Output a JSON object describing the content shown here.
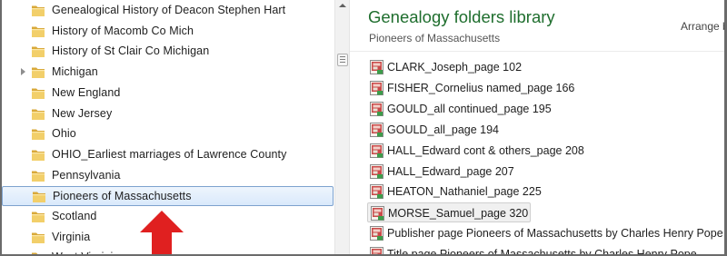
{
  "nav": {
    "items": [
      {
        "label": "Genealogical History of Deacon Stephen Hart",
        "expandable": false
      },
      {
        "label": "History of Macomb Co Mich",
        "expandable": false
      },
      {
        "label": "History of St Clair Co Michigan",
        "expandable": false
      },
      {
        "label": "Michigan",
        "expandable": true
      },
      {
        "label": "New England",
        "expandable": false
      },
      {
        "label": "New Jersey",
        "expandable": false
      },
      {
        "label": "Ohio",
        "expandable": false
      },
      {
        "label": "OHIO_Earliest marriages of Lawrence County",
        "expandable": false
      },
      {
        "label": "Pennsylvania",
        "expandable": false
      },
      {
        "label": "Pioneers of Massachusetts",
        "expandable": false,
        "selected": true
      },
      {
        "label": "Scotland",
        "expandable": false
      },
      {
        "label": "Virginia",
        "expandable": false
      },
      {
        "label": "West Virginia",
        "expandable": false
      }
    ]
  },
  "library": {
    "title": "Genealogy folders library",
    "subtitle": "Pioneers of Massachusetts",
    "arrange_label": "Arrange b",
    "files": [
      {
        "label": "CLARK_Joseph_page 102"
      },
      {
        "label": "FISHER_Cornelius named_page 166"
      },
      {
        "label": "GOULD_all continued_page 195"
      },
      {
        "label": "GOULD_all_page 194"
      },
      {
        "label": "HALL_Edward cont & others_page 208"
      },
      {
        "label": "HALL_Edward_page 207"
      },
      {
        "label": "HEATON_Nathaniel_page 225"
      },
      {
        "label": "MORSE_Samuel_page 320",
        "hover": true
      },
      {
        "label": "Publisher page Pioneers of Massachusetts by Charles Henry Pope"
      },
      {
        "label": "Title page Pioneers of Massachusetts by Charles Henry Pope"
      }
    ]
  },
  "colors": {
    "title": "#1f6e2e",
    "selection": "#d9e9fb",
    "selection_border": "#7da2ce",
    "folder": "#e8c35a",
    "arrow": "#e02020"
  },
  "icons": {
    "folder": "folder-icon",
    "file": "image-file-icon",
    "pointer": "red-up-arrow-icon"
  }
}
